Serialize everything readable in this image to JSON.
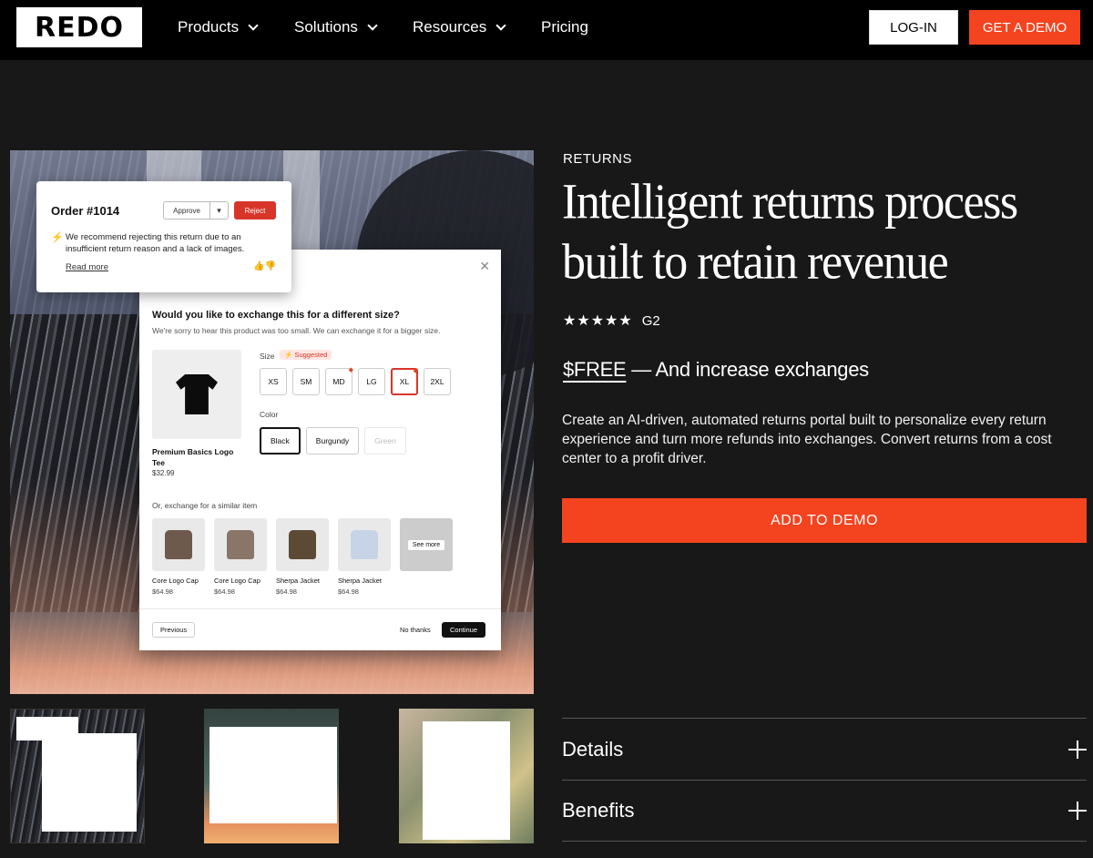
{
  "brand": {
    "logo_text": "REDO"
  },
  "nav": {
    "items": [
      {
        "label": "Products",
        "has_dropdown": true
      },
      {
        "label": "Solutions",
        "has_dropdown": true
      },
      {
        "label": "Resources",
        "has_dropdown": true
      },
      {
        "label": "Pricing",
        "has_dropdown": false
      }
    ],
    "login_label": "LOG-IN",
    "demo_label": "GET A DEMO"
  },
  "hero_mockup": {
    "order_card": {
      "title": "Order #1014",
      "approve_label": "Approve",
      "reject_label": "Reject",
      "message": "We recommend rejecting this return due to an insufficient return reason and a lack of images.",
      "read_more": "Read more"
    },
    "exchange_modal": {
      "question": "Would you like to exchange this for a different size?",
      "subtext": "We're sorry to hear this product was too small. We can exchange it for a bigger size.",
      "product_name": "Premium Basics Logo Tee",
      "product_price": "$32.99",
      "size_label": "Size",
      "suggested_label": "Suggested",
      "sizes": [
        "XS",
        "SM",
        "MD",
        "LG",
        "XL",
        "2XL"
      ],
      "selected_size": "XL",
      "color_label": "Color",
      "colors": [
        "Black",
        "Burgundy",
        "Green"
      ],
      "selected_color": "Black",
      "similar_label": "Or, exchange for a similar item",
      "similar_items": [
        {
          "name": "Core Logo Cap",
          "price": "$64.98",
          "color": "#6e5a4d"
        },
        {
          "name": "Core Logo Cap",
          "price": "$64.98",
          "color": "#8a7668"
        },
        {
          "name": "Sherpa Jacket",
          "price": "$64.98",
          "color": "#5c4a35"
        },
        {
          "name": "Sherpa Jacket",
          "price": "$64.98",
          "color": "#c7d3e6"
        }
      ],
      "see_more_label": "See more",
      "previous_label": "Previous",
      "no_thanks_label": "No thanks",
      "continue_label": "Continue"
    }
  },
  "content": {
    "eyebrow": "RETURNS",
    "headline": "Intelligent returns process built to retain revenue",
    "rating": {
      "stars": "★★★★★",
      "source": "G2"
    },
    "price_free": "$FREE",
    "price_rest": " — And increase exchanges",
    "description": "Create an AI-driven, automated returns portal built to personalize every return experience and turn more refunds into exchanges. Convert returns from a cost center to a profit driver.",
    "cta_label": "ADD TO DEMO",
    "accordion": [
      {
        "label": "Details"
      },
      {
        "label": "Benefits"
      }
    ]
  },
  "colors": {
    "accent": "#f4431f",
    "background": "#181818",
    "nav_bg": "#000000"
  }
}
